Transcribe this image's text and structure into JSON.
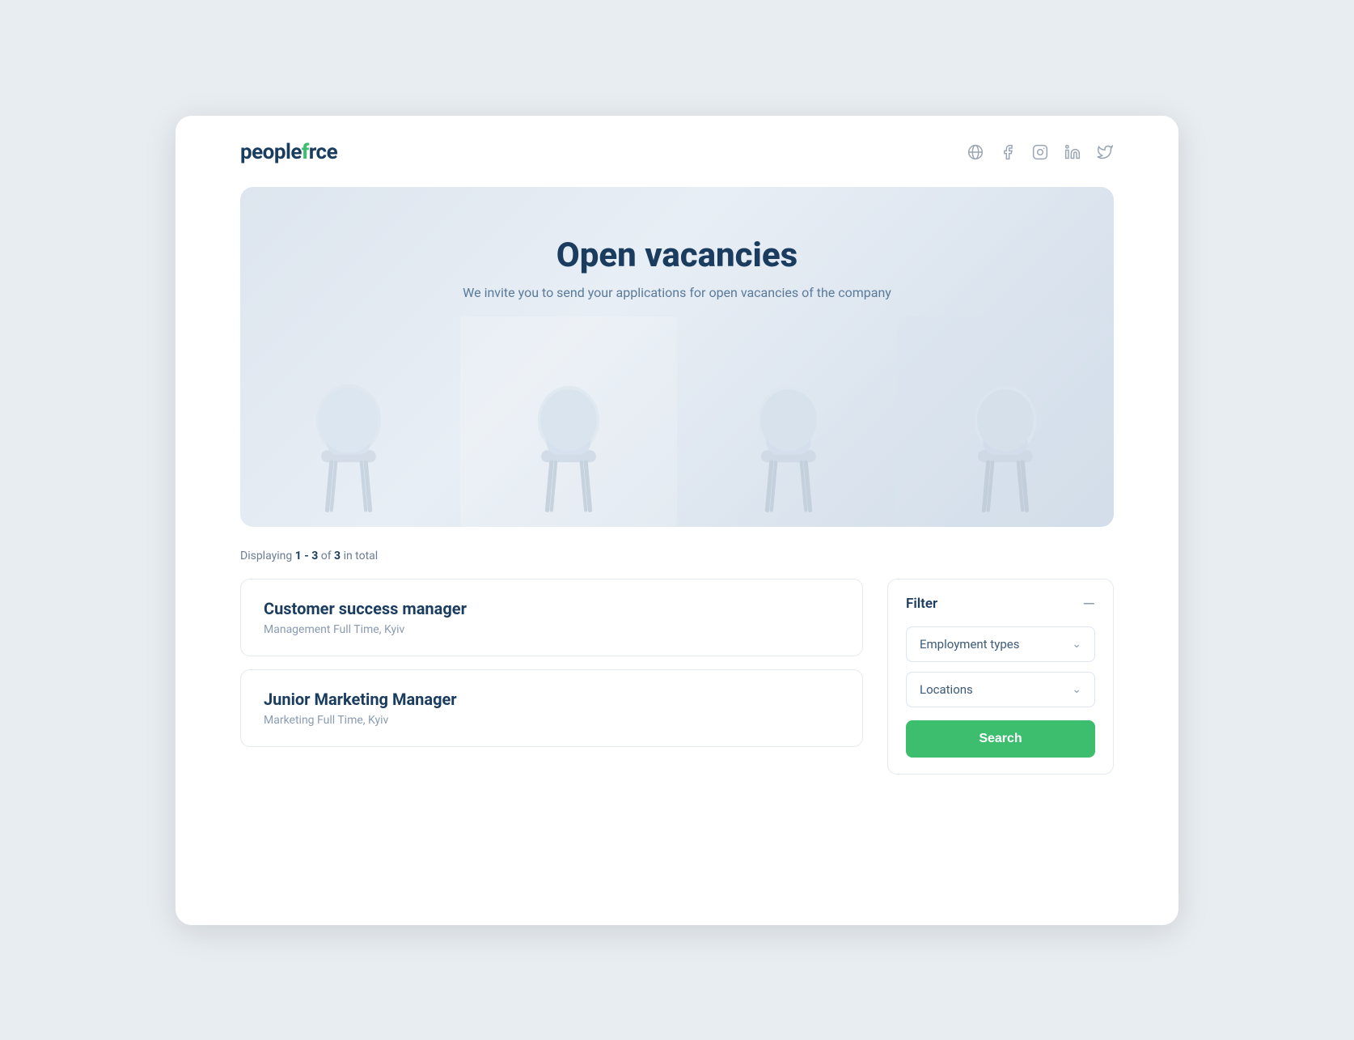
{
  "logo": {
    "text_people": "people",
    "text_force": "rce",
    "text_f": "f"
  },
  "social_icons": [
    {
      "name": "globe-icon",
      "label": "Website"
    },
    {
      "name": "facebook-icon",
      "label": "Facebook"
    },
    {
      "name": "instagram-icon",
      "label": "Instagram"
    },
    {
      "name": "linkedin-icon",
      "label": "LinkedIn"
    },
    {
      "name": "twitter-icon",
      "label": "Twitter"
    }
  ],
  "hero": {
    "title": "Open vacancies",
    "subtitle": "We invite you to send your applications for open vacancies of the company"
  },
  "stats": {
    "prefix": "Displaying ",
    "range": "1 - 3",
    "middle": " of ",
    "total": "3",
    "suffix": " in total"
  },
  "jobs": [
    {
      "title": "Customer success manager",
      "meta": "Management Full Time, Kyiv"
    },
    {
      "title": "Junior Marketing Manager",
      "meta": "Marketing Full Time, Kyiv"
    }
  ],
  "filter": {
    "title": "Filter",
    "collapse_icon": "—",
    "employment_types_label": "Employment types",
    "locations_label": "Locations",
    "search_button_label": "Search"
  }
}
